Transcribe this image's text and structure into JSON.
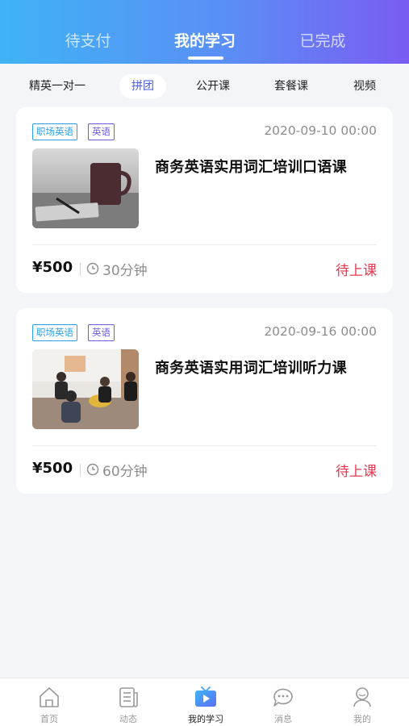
{
  "top_tabs": [
    {
      "label": "待支付"
    },
    {
      "label": "我的学习"
    },
    {
      "label": "已完成"
    }
  ],
  "categories": [
    {
      "label": "精英一对一"
    },
    {
      "label": "拼团"
    },
    {
      "label": "公开课"
    },
    {
      "label": "套餐课"
    },
    {
      "label": "视频"
    }
  ],
  "active_category": "拼团",
  "courses": [
    {
      "tags": [
        "职场英语",
        "英语"
      ],
      "date": "2020-09-10 00:00",
      "title": "商务英语实用词汇培训口语课",
      "price": "¥500",
      "duration": "30分钟",
      "status": "待上课"
    },
    {
      "tags": [
        "职场英语",
        "英语"
      ],
      "date": "2020-09-16 00:00",
      "title": "商务英语实用词汇培训听力课",
      "price": "¥500",
      "duration": "60分钟",
      "status": "待上课"
    }
  ],
  "bottom_nav": [
    {
      "label": "首页",
      "icon": "home-icon"
    },
    {
      "label": "动态",
      "icon": "news-icon"
    },
    {
      "label": "我的学习",
      "icon": "tv-play-icon"
    },
    {
      "label": "消息",
      "icon": "message-icon"
    },
    {
      "label": "我的",
      "icon": "user-icon"
    }
  ],
  "colors": {
    "header_gradient_start": "#3fb3f6",
    "header_gradient_end": "#7a5cf2",
    "status_red": "#e8354c",
    "tag_blue": "#27a1ea",
    "tag_purple": "#6b5be6",
    "active_category": "#4a5de8"
  }
}
